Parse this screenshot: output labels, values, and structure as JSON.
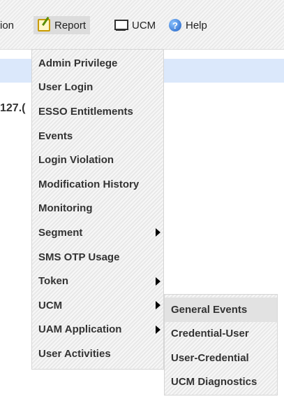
{
  "menubar": {
    "items": [
      {
        "label": "ion"
      },
      {
        "label": "Report",
        "icon": "report-icon"
      },
      {
        "label": "UCM",
        "icon": "monitor-icon"
      },
      {
        "label": "Help",
        "icon": "help-icon"
      }
    ]
  },
  "page": {
    "partial_text": "127.("
  },
  "report_menu": {
    "items": [
      {
        "label": "Admin Privilege"
      },
      {
        "label": "User Login"
      },
      {
        "label": "ESSO Entitlements"
      },
      {
        "label": "Events"
      },
      {
        "label": "Login Violation"
      },
      {
        "label": "Modification History"
      },
      {
        "label": "Monitoring"
      },
      {
        "label": "Segment",
        "has_submenu": true
      },
      {
        "label": "SMS OTP Usage"
      },
      {
        "label": "Token",
        "has_submenu": true
      },
      {
        "label": "UCM",
        "has_submenu": true
      },
      {
        "label": "UAM Application",
        "has_submenu": true
      },
      {
        "label": "User Activities"
      }
    ]
  },
  "ucm_submenu": {
    "items": [
      {
        "label": "General Events"
      },
      {
        "label": "Credential-User"
      },
      {
        "label": "User-Credential"
      },
      {
        "label": "UCM Diagnostics"
      }
    ]
  }
}
